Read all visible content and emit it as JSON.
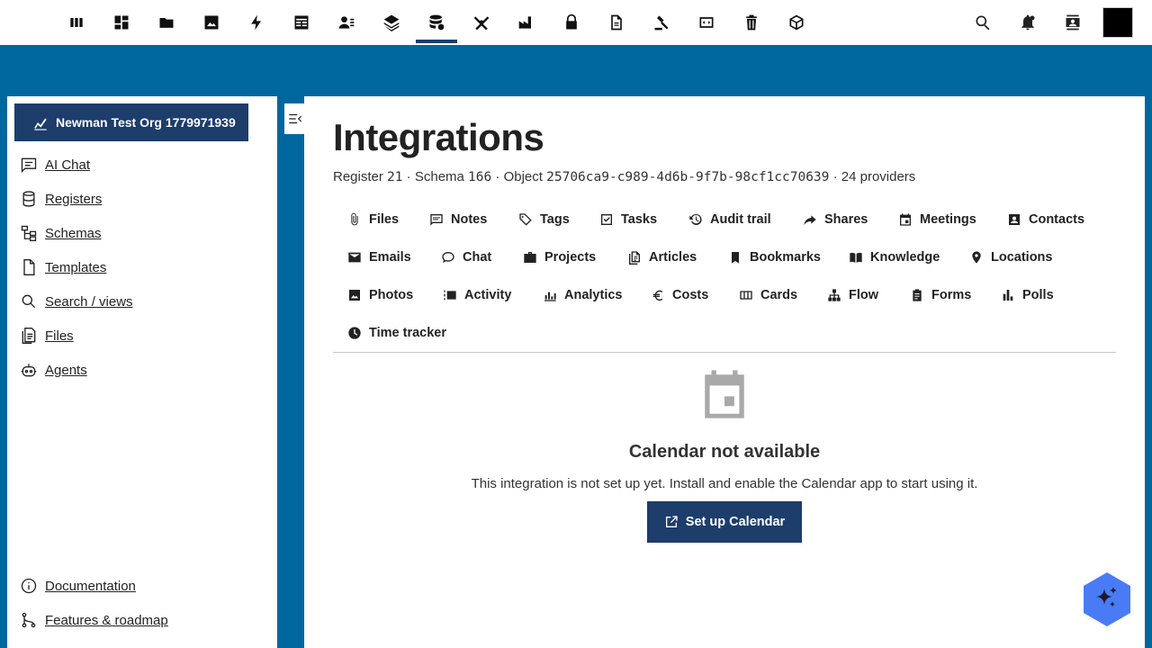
{
  "topbar": {
    "apps": [
      {
        "icon": "dashboard-bars-icon"
      },
      {
        "icon": "grid-icon"
      },
      {
        "icon": "folder-icon"
      },
      {
        "icon": "image-icon"
      },
      {
        "icon": "lightning-icon"
      },
      {
        "icon": "table-icon"
      },
      {
        "icon": "contacts-list-icon"
      },
      {
        "icon": "layers-icon"
      },
      {
        "icon": "database-icon"
      },
      {
        "icon": "crossed-tools-icon"
      },
      {
        "icon": "factory-icon"
      },
      {
        "icon": "lock-icon"
      },
      {
        "icon": "document-icon"
      },
      {
        "icon": "gavel-icon"
      },
      {
        "icon": "code-window-icon"
      },
      {
        "icon": "trash-icon"
      },
      {
        "icon": "cube-icon"
      }
    ],
    "active_index": 8,
    "right_icons": [
      "search-icon",
      "notifications-icon",
      "contacts-icon",
      "user-avatar"
    ]
  },
  "sidebar": {
    "org_label": "Newman Test Org 1779971939",
    "items": [
      {
        "label": "AI Chat",
        "icon": "chat-icon"
      },
      {
        "label": "Registers",
        "icon": "database-icon"
      },
      {
        "label": "Schemas",
        "icon": "schema-icon"
      },
      {
        "label": "Templates",
        "icon": "file-icon"
      },
      {
        "label": "Search / views",
        "icon": "search-icon"
      },
      {
        "label": "Files",
        "icon": "files-icon"
      },
      {
        "label": "Agents",
        "icon": "robot-icon"
      }
    ],
    "footer_items": [
      {
        "label": "Documentation",
        "icon": "info-icon"
      },
      {
        "label": "Features & roadmap",
        "icon": "roadmap-icon"
      }
    ]
  },
  "main": {
    "title": "Integrations",
    "meta": {
      "register_label": "Register",
      "register_value": "21",
      "schema_label": "Schema",
      "schema_value": "166",
      "object_label": "Object",
      "object_value": "25706ca9-c989-4d6b-9f7b-98cf1cc70639",
      "providers": "24 providers",
      "sep": " · "
    },
    "tabs": [
      {
        "label": "Files",
        "icon": "paperclip-icon"
      },
      {
        "label": "Notes",
        "icon": "note-icon"
      },
      {
        "label": "Tags",
        "icon": "tag-icon"
      },
      {
        "label": "Tasks",
        "icon": "checkbox-icon"
      },
      {
        "label": "Audit trail",
        "icon": "history-icon"
      },
      {
        "label": "Shares",
        "icon": "share-icon"
      },
      {
        "label": "Meetings",
        "icon": "calendar-icon"
      },
      {
        "label": "Contacts",
        "icon": "contact-card-icon"
      },
      {
        "label": "Emails",
        "icon": "email-icon"
      },
      {
        "label": "Chat",
        "icon": "chat-bubble-icon"
      },
      {
        "label": "Projects",
        "icon": "briefcase-icon"
      },
      {
        "label": "Articles",
        "icon": "article-icon"
      },
      {
        "label": "Bookmarks",
        "icon": "bookmark-icon"
      },
      {
        "label": "Knowledge",
        "icon": "book-icon"
      },
      {
        "label": "Locations",
        "icon": "location-pin-icon"
      },
      {
        "label": "Photos",
        "icon": "photo-icon"
      },
      {
        "label": "Activity",
        "icon": "activity-icon"
      },
      {
        "label": "Analytics",
        "icon": "analytics-icon"
      },
      {
        "label": "Costs",
        "icon": "euro-icon"
      },
      {
        "label": "Cards",
        "icon": "cards-icon"
      },
      {
        "label": "Flow",
        "icon": "flow-icon"
      },
      {
        "label": "Forms",
        "icon": "clipboard-icon"
      },
      {
        "label": "Polls",
        "icon": "poll-icon"
      },
      {
        "label": "Time tracker",
        "icon": "clock-icon"
      }
    ],
    "empty_state": {
      "icon": "calendar-icon",
      "title": "Calendar not available",
      "description": "This integration is not set up yet. Install and enable the Calendar app to start using it.",
      "button_label": "Set up Calendar",
      "button_icon": "external-link-icon"
    }
  },
  "fab": {
    "icon": "sparkles-icon",
    "color": "#4a7bf7"
  },
  "colors": {
    "brand": "#00679e",
    "primary_button": "#1d3d6b",
    "active_indicator": "#1d3d6b"
  }
}
